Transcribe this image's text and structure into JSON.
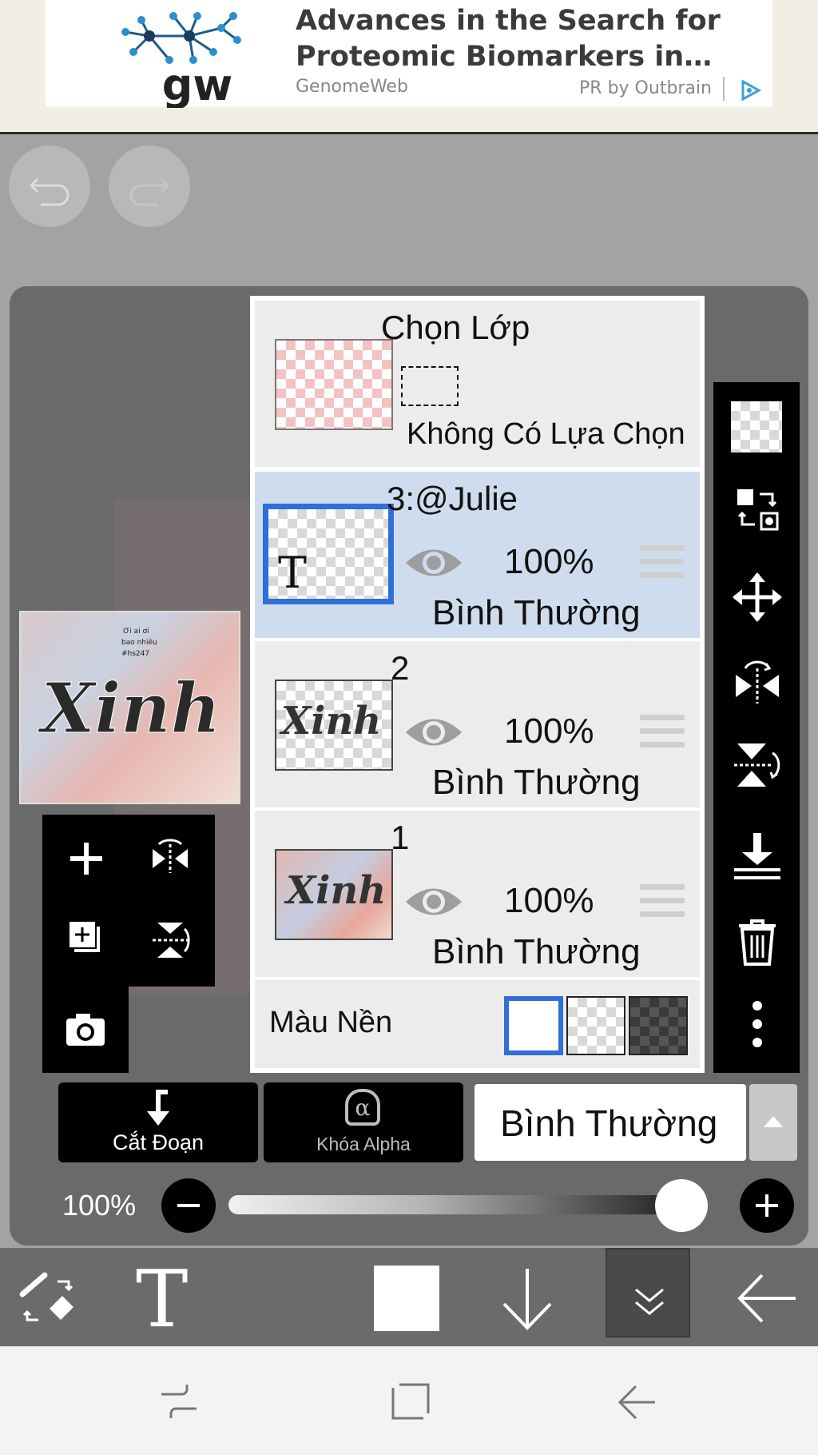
{
  "ad": {
    "logo_text": "gw",
    "title": "Advances in the Search for Proteomic Biomarkers in…",
    "source": "GenomeWeb",
    "sponsor": "PR by Outbrain"
  },
  "toolbar_top": {
    "undo_icon": "undo-icon",
    "redo_icon": "redo-icon"
  },
  "layer_panel": {
    "selection": {
      "title": "Chọn Lớp",
      "subtitle": "Không Có Lựa Chọn"
    },
    "layers": [
      {
        "name": "3:@Julie",
        "opacity": "100%",
        "mode": "Bình Thường",
        "selected": true,
        "thumb_text": "T"
      },
      {
        "name": "2",
        "opacity": "100%",
        "mode": "Bình Thường",
        "selected": false,
        "thumb_text": "Xinh"
      },
      {
        "name": "1",
        "opacity": "100%",
        "mode": "Bình Thường",
        "selected": false,
        "thumb_text": "Xinh"
      }
    ],
    "background": {
      "label": "Màu Nền"
    }
  },
  "canvas": {
    "art_text": "Xinh"
  },
  "controls": {
    "clip_label": "Cắt Đoạn",
    "alpha_lock_label": "Khóa Alpha",
    "alpha_symbol": "α",
    "blend_mode": "Bình Thường",
    "opacity_label": "100%",
    "opacity_value": 1.0
  },
  "colors": {
    "selected_border": "#2f6fd8",
    "selected_row": "#cfdcee",
    "panel_bg": "#ececec"
  }
}
